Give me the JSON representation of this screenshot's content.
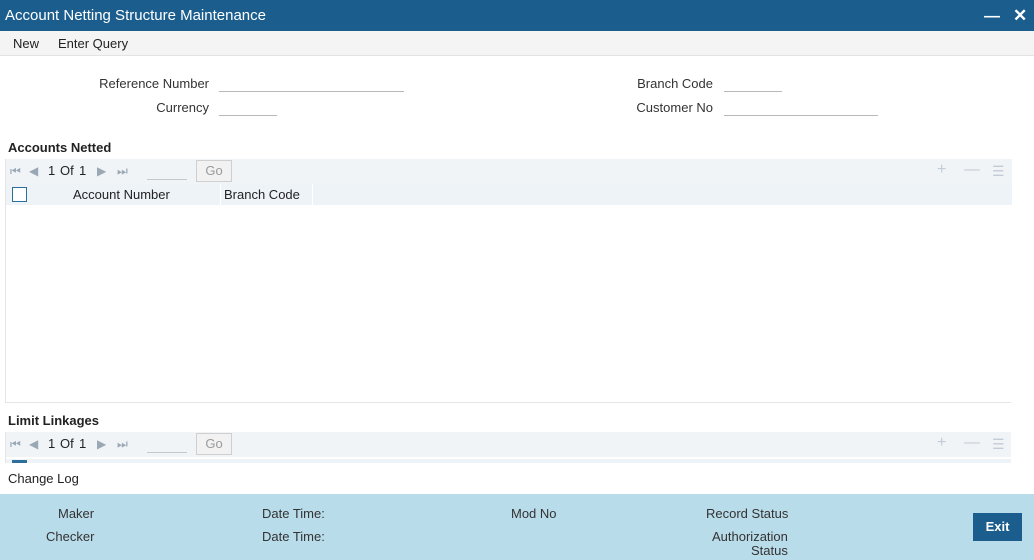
{
  "window": {
    "title": "Account Netting Structure Maintenance",
    "minimize_glyph": "▬",
    "close_glyph": "✕"
  },
  "menu": {
    "new": "New",
    "enter_query": "Enter Query"
  },
  "form": {
    "reference_number_label": "Reference Number",
    "currency_label": "Currency",
    "branch_code_label": "Branch Code",
    "customer_no_label": "Customer No",
    "reference_number": "",
    "currency": "",
    "branch_code": "",
    "customer_no": ""
  },
  "accounts_netted": {
    "title": "Accounts Netted",
    "page_current": "1",
    "page_of": "Of",
    "page_total": "1",
    "go": "Go",
    "columns": [
      "Account Number",
      "Branch Code"
    ],
    "rows": []
  },
  "limit_linkages": {
    "title": "Limit Linkages",
    "page_current": "1",
    "page_of": "Of",
    "page_total": "1",
    "go": "Go"
  },
  "change_log": "Change Log",
  "footer": {
    "maker": "Maker",
    "checker": "Checker",
    "date_time_1": "Date Time:",
    "date_time_2": "Date Time:",
    "mod_no": "Mod No",
    "record_status": "Record Status",
    "authorization": "Authorization",
    "status": "Status",
    "exit": "Exit"
  },
  "icons": {
    "first": "first-page-icon",
    "prev": "previous-page-icon",
    "next": "next-page-icon",
    "last": "last-page-icon",
    "add": "add-row-icon",
    "delete": "delete-row-icon",
    "columns": "column-settings-icon"
  },
  "colors": {
    "titlebar": "#1b5e8e",
    "footer": "#b9dcea",
    "grid_header": "#eef3f8"
  }
}
